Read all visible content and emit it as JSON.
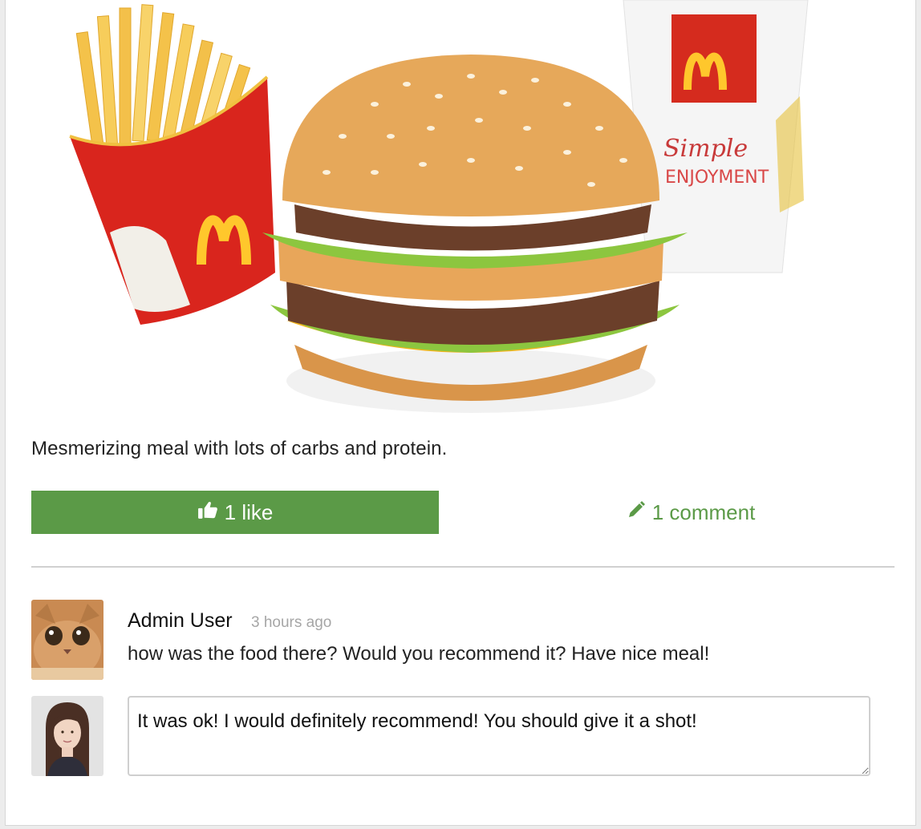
{
  "post": {
    "image_alt": "McDonald's Big Mac meal with fries and drink",
    "caption": "Mesmerizing meal with lots of carbs and protein.",
    "like_label": "1 like",
    "comment_label": "1 comment"
  },
  "comments": [
    {
      "author": "Admin User",
      "time": "3 hours ago",
      "text": "how was the food there? Would you recommend it? Have nice meal!",
      "avatar": "cat-avatar"
    }
  ],
  "reply": {
    "value": "It was ok! I would definitely recommend! You should give it a shot!",
    "avatar": "woman-avatar"
  },
  "colors": {
    "accent": "#5b9a47",
    "divider": "#d0d0d0",
    "muted_text": "#a6a6a6"
  },
  "icons": {
    "like": "thumbs-up-icon",
    "comment": "pencil-icon"
  }
}
